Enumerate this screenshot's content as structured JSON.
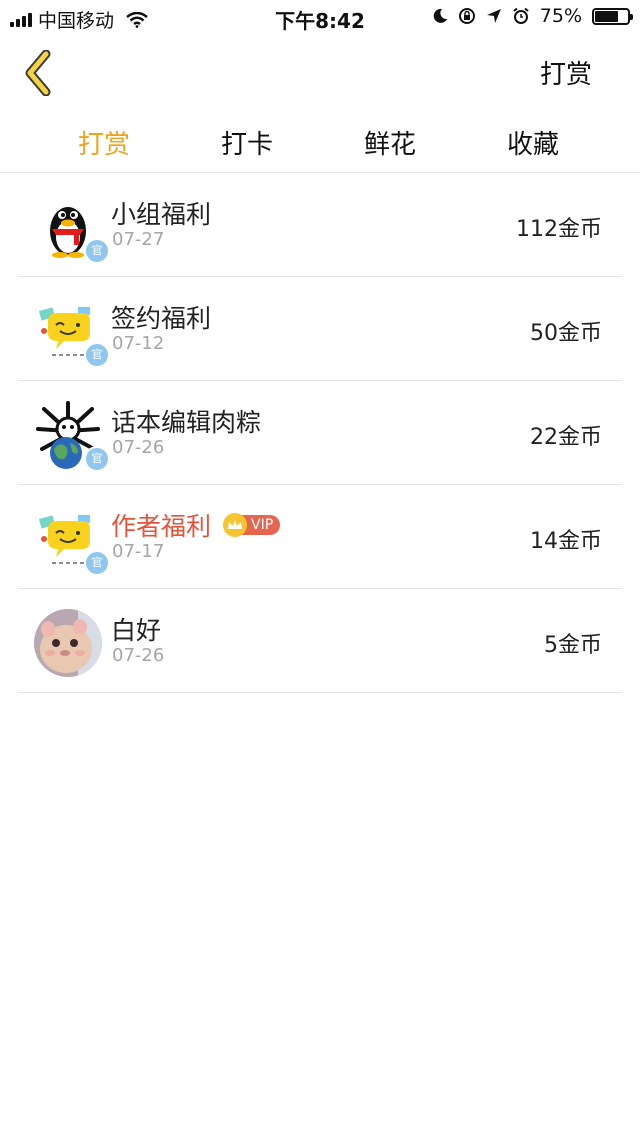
{
  "status_bar": {
    "carrier": "中国移动",
    "time": "下午8:42",
    "battery": "75%",
    "battery_level": 0.75
  },
  "nav": {
    "back_icon": "chevron-left-icon",
    "action_label": "打赏"
  },
  "tabs": [
    {
      "label": "打赏",
      "active": true
    },
    {
      "label": "打卡",
      "active": false
    },
    {
      "label": "鲜花",
      "active": false
    },
    {
      "label": "收藏",
      "active": false
    }
  ],
  "list": [
    {
      "name": "小组福利",
      "date": "07-27",
      "amount": "112金币",
      "avatar": "penguin-avatar",
      "official": true,
      "vip": false
    },
    {
      "name": "签约福利",
      "date": "07-12",
      "amount": "50金币",
      "avatar": "chat-bubble-avatar",
      "official": true,
      "vip": false
    },
    {
      "name": "话本编辑肉粽",
      "date": "07-26",
      "amount": "22金币",
      "avatar": "earth-spider-avatar",
      "official": true,
      "vip": false
    },
    {
      "name": "作者福利",
      "date": "07-17",
      "amount": "14金币",
      "avatar": "chat-bubble-avatar",
      "official": true,
      "vip": true
    },
    {
      "name": "白好",
      "date": "07-26",
      "amount": "5金币",
      "avatar": "hamster-photo-avatar",
      "official": false,
      "vip": false
    }
  ],
  "badges": {
    "official_label": "官",
    "vip_label": "VIP"
  },
  "colors": {
    "accent": "#f2a31b",
    "vip_name": "#e5533b",
    "vip_tag": "#e5664f",
    "official_badge": "#8fc7ee"
  }
}
